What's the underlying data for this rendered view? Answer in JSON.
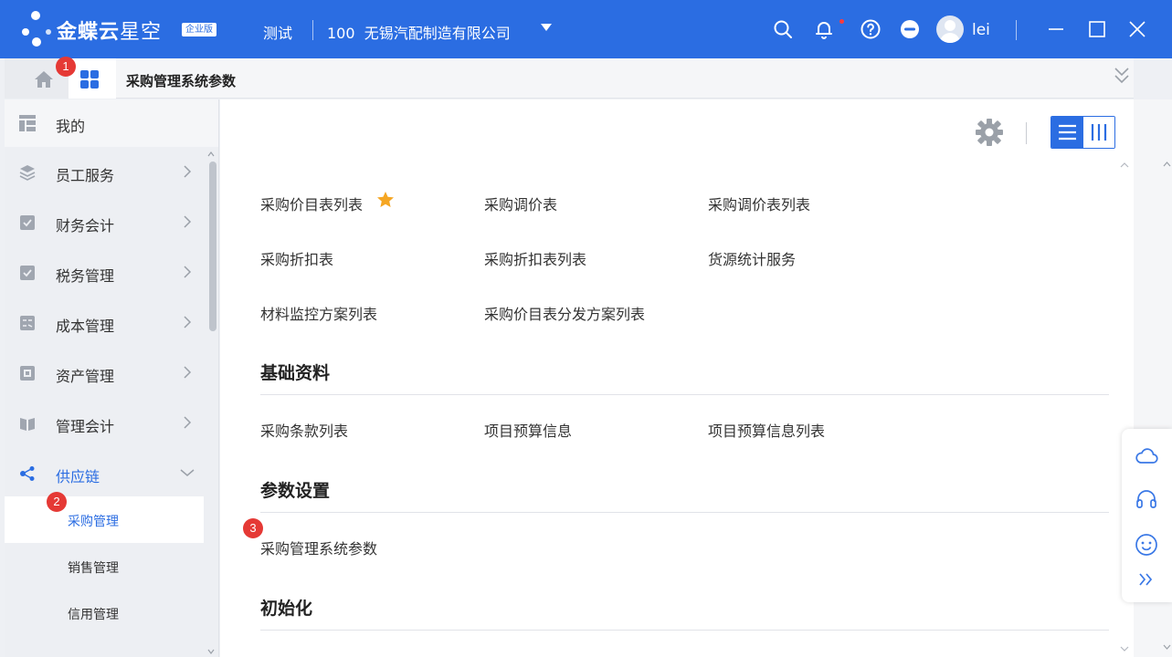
{
  "topbar": {
    "brand": "金蝶云",
    "product": "星空",
    "edition": "企业版",
    "environment": "测试",
    "org_code": "100",
    "org_name": "无锡汽配制造有限公司",
    "username": "lei",
    "icons": [
      "search-icon",
      "bell-icon",
      "help-icon",
      "more-icon",
      "minimize-icon",
      "maximize-icon",
      "close-icon"
    ]
  },
  "tabbar": {
    "active_tab": "采购管理系统参数",
    "badge1": "1"
  },
  "sidebar": {
    "mine": "我的",
    "items": [
      {
        "label": "员工服务",
        "icon": "layers-icon"
      },
      {
        "label": "财务会计",
        "icon": "finance-icon"
      },
      {
        "label": "税务管理",
        "icon": "tax-icon"
      },
      {
        "label": "成本管理",
        "icon": "calculator-icon"
      },
      {
        "label": "资产管理",
        "icon": "asset-icon"
      },
      {
        "label": "管理会计",
        "icon": "book-icon"
      },
      {
        "label": "供应链",
        "icon": "share-icon"
      }
    ],
    "subitems": [
      "采购管理",
      "销售管理",
      "信用管理"
    ],
    "badge2": "2"
  },
  "main": {
    "reports": {
      "row1": [
        "采购价目表列表",
        "采购调价表",
        "采购调价表列表"
      ],
      "row2": [
        "采购折扣表",
        "采购折扣表列表",
        "货源统计服务"
      ],
      "row3": [
        "材料监控方案列表",
        "采购价目表分发方案列表"
      ]
    },
    "basic": {
      "title": "基础资料",
      "items": [
        "采购条款列表",
        "项目预算信息",
        "项目预算信息列表"
      ]
    },
    "params": {
      "title": "参数设置",
      "items": [
        "采购管理系统参数"
      ],
      "badge3": "3"
    },
    "init": {
      "title": "初始化"
    }
  },
  "colors": {
    "primary": "#2b6de2",
    "badge": "#e53935",
    "star": "#f5a623"
  }
}
